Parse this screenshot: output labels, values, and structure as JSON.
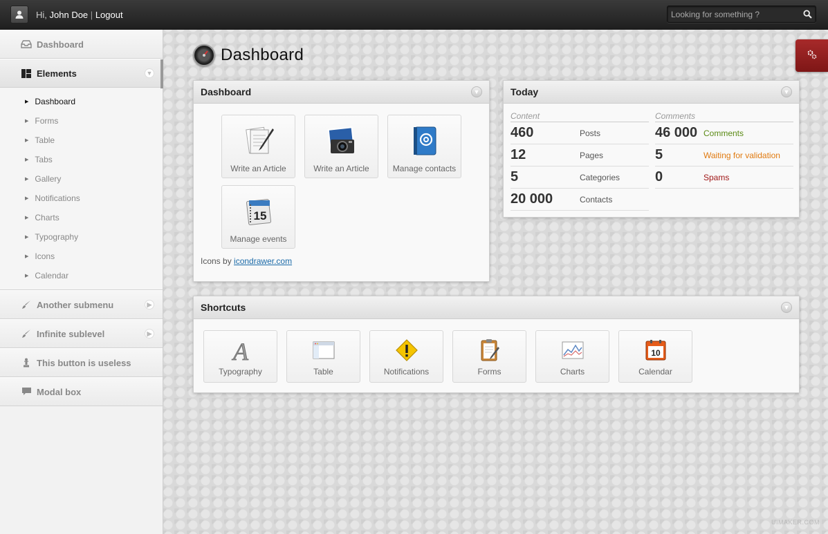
{
  "topbar": {
    "greeting_prefix": "Hi,",
    "user_name": "John Doe",
    "separator": "|",
    "logout_label": "Logout",
    "search_placeholder": "Looking for something ?"
  },
  "sidebar": {
    "items": [
      {
        "label": "Dashboard",
        "icon": "inbox-icon"
      },
      {
        "label": "Elements",
        "icon": "layout-icon"
      },
      {
        "label": "Another submenu",
        "icon": "brush-icon"
      },
      {
        "label": "Infinite sublevel",
        "icon": "brush-icon"
      },
      {
        "label": "This button is useless",
        "icon": "pawn-icon"
      },
      {
        "label": "Modal box",
        "icon": "speech-bubble-icon"
      }
    ],
    "submenu": [
      "Dashboard",
      "Forms",
      "Table",
      "Tabs",
      "Gallery",
      "Notifications",
      "Charts",
      "Typography",
      "Icons",
      "Calendar"
    ]
  },
  "page": {
    "title": "Dashboard"
  },
  "dashboard_box": {
    "title": "Dashboard",
    "tiles": [
      {
        "label": "Write an Article",
        "icon": "document-pen-icon"
      },
      {
        "label": "Write an Article",
        "icon": "camera-photo-icon"
      },
      {
        "label": "Manage contacts",
        "icon": "address-book-icon"
      },
      {
        "label": "Manage events",
        "icon": "calendar-15-icon"
      }
    ],
    "credits_prefix": "Icons by",
    "credits_link": "icondrawer.com"
  },
  "today_box": {
    "title": "Today",
    "content_head": "Content",
    "comments_head": "Comments",
    "content_rows": [
      {
        "num": "460",
        "label": "Posts"
      },
      {
        "num": "12",
        "label": "Pages"
      },
      {
        "num": "5",
        "label": "Categories"
      },
      {
        "num": "20 000",
        "label": "Contacts"
      }
    ],
    "comment_rows": [
      {
        "num": "46 000",
        "label": "Comments",
        "color": "#5a8a14"
      },
      {
        "num": "5",
        "label": "Waiting for validation",
        "color": "#e07a10"
      },
      {
        "num": "0",
        "label": "Spams",
        "color": "#a01818"
      }
    ]
  },
  "shortcuts_box": {
    "title": "Shortcuts",
    "items": [
      {
        "label": "Typography",
        "icon": "font-a-icon"
      },
      {
        "label": "Table",
        "icon": "window-table-icon"
      },
      {
        "label": "Notifications",
        "icon": "warning-icon"
      },
      {
        "label": "Forms",
        "icon": "clipboard-icon"
      },
      {
        "label": "Charts",
        "icon": "line-chart-icon"
      },
      {
        "label": "Calendar",
        "icon": "calendar-10-icon"
      }
    ]
  },
  "colors": {
    "accent_red": "#8e1e1e",
    "link_blue": "#1a6aa8"
  },
  "watermark": "UIMAKER.COM"
}
